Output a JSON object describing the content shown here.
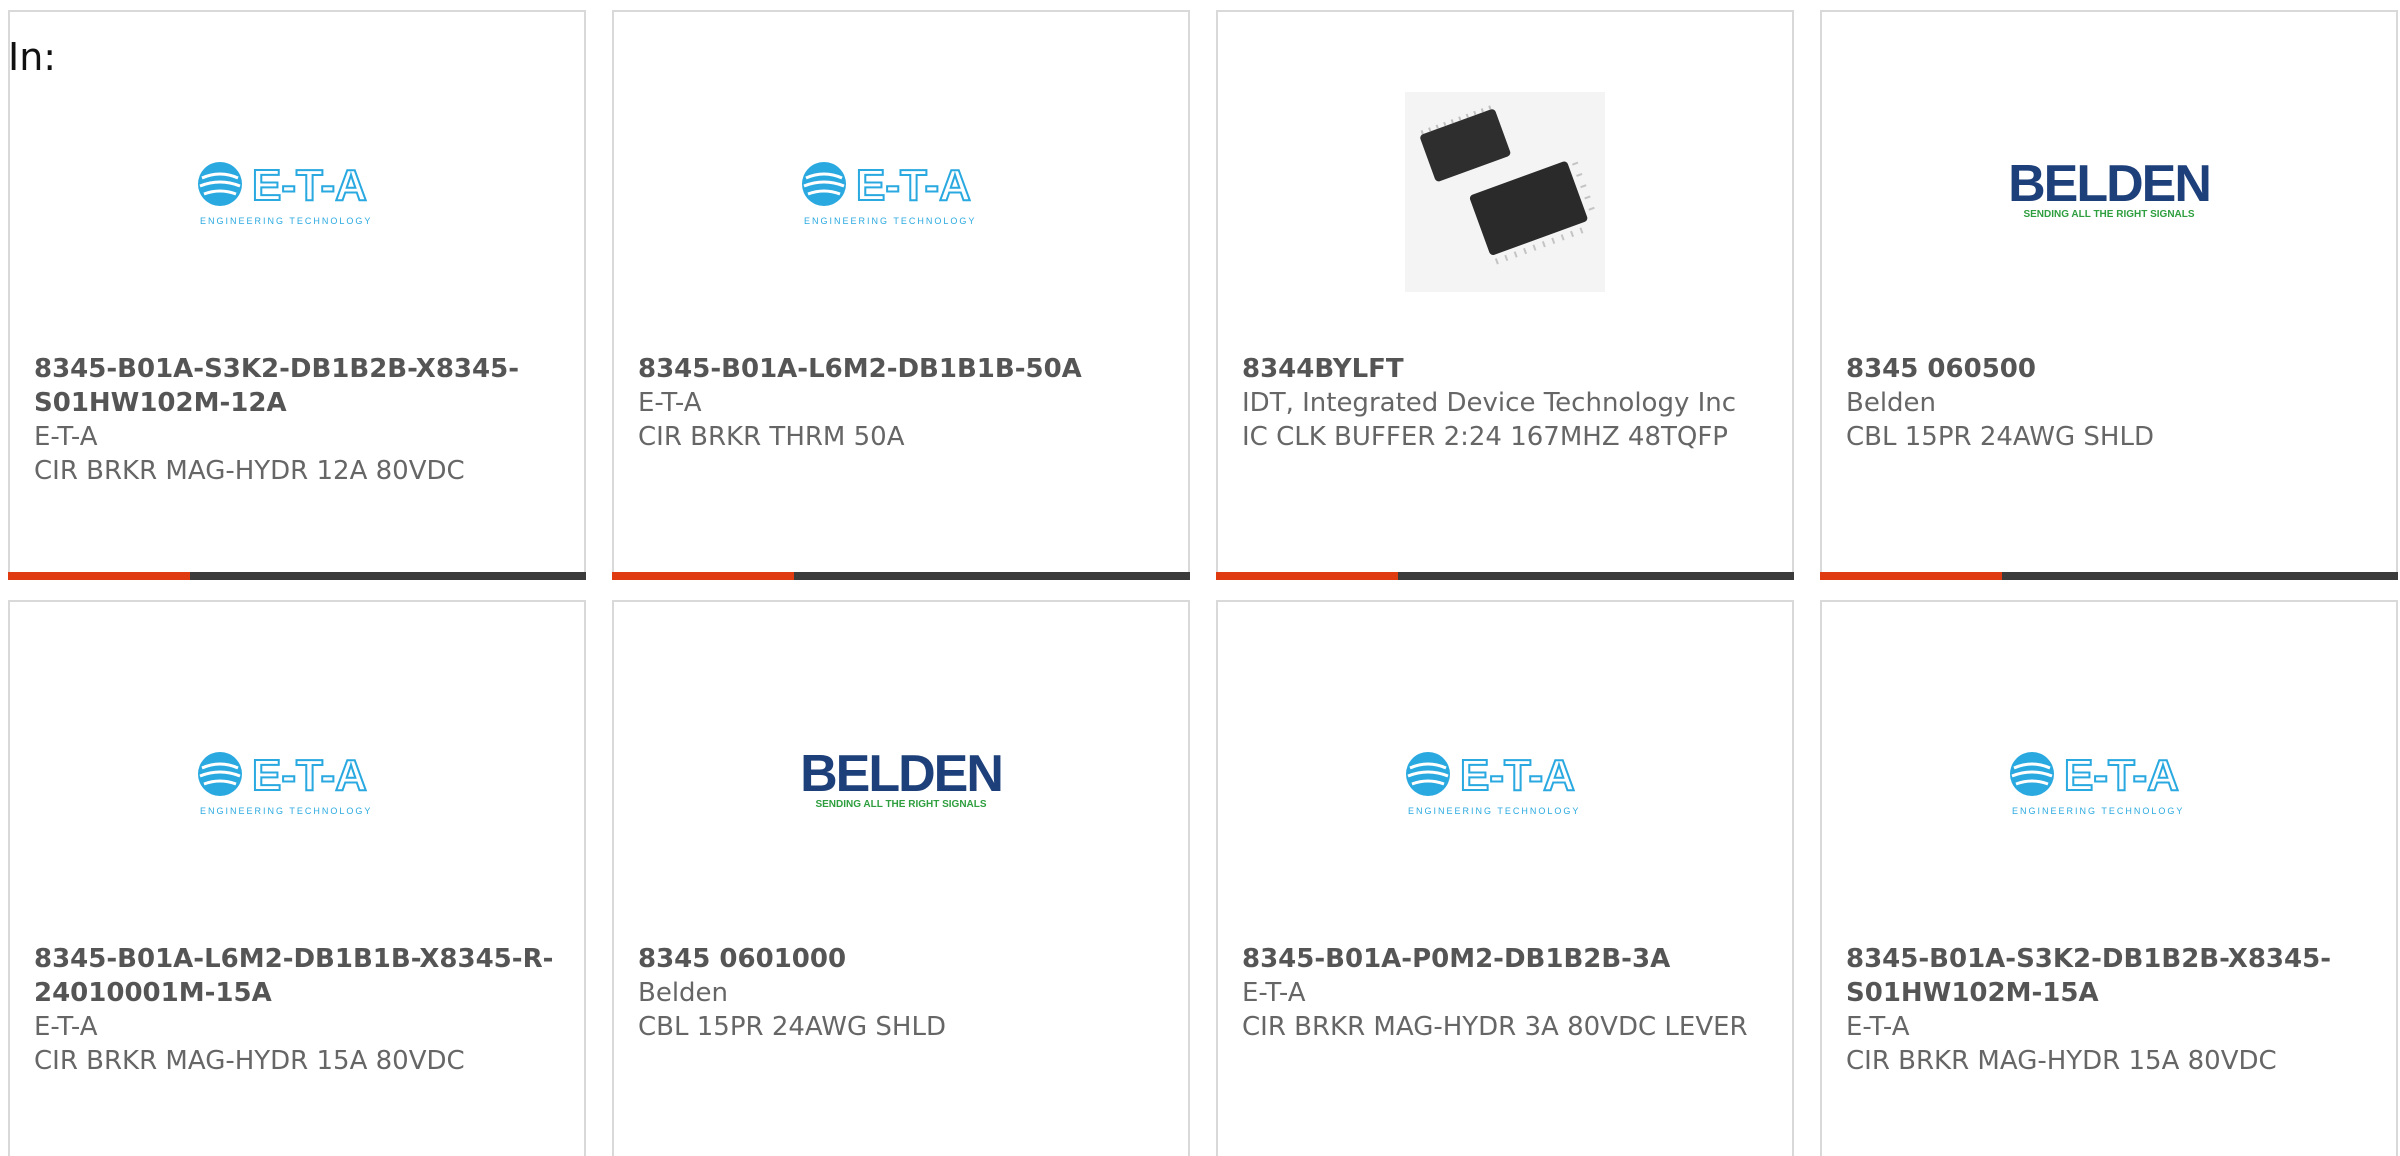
{
  "header": {
    "in_label": "In:"
  },
  "products": [
    {
      "part_number": "8345-B01A-S3K2-DB1B2B-X8345-S01HW102M-12A",
      "manufacturer": "E-T-A",
      "description": "CIR BRKR MAG-HYDR 12A 80VDC",
      "image": "eta-logo"
    },
    {
      "part_number": "8345-B01A-L6M2-DB1B1B-50A",
      "manufacturer": "E-T-A",
      "description": "CIR BRKR THRM 50A",
      "image": "eta-logo"
    },
    {
      "part_number": "8344BYLFT",
      "manufacturer": "IDT, Integrated Device Technology Inc",
      "description": "IC CLK BUFFER 2:24 167MHZ 48TQFP",
      "image": "tqfp-chip-photo"
    },
    {
      "part_number": "8345 060500",
      "manufacturer": "Belden",
      "description": "CBL 15PR 24AWG SHLD",
      "image": "belden-logo"
    },
    {
      "part_number": "8345-B01A-L6M2-DB1B1B-X8345-R-24010001M-15A",
      "manufacturer": "E-T-A",
      "description": "CIR BRKR MAG-HYDR 15A 80VDC",
      "image": "eta-logo"
    },
    {
      "part_number": "8345 0601000",
      "manufacturer": "Belden",
      "description": "CBL 15PR 24AWG SHLD",
      "image": "belden-logo"
    },
    {
      "part_number": "8345-B01A-P0M2-DB1B2B-3A",
      "manufacturer": "E-T-A",
      "description": "CIR BRKR MAG-HYDR 3A 80VDC LEVER",
      "image": "eta-logo"
    },
    {
      "part_number": "8345-B01A-S3K2-DB1B2B-X8345-S01HW102M-15A",
      "manufacturer": "E-T-A",
      "description": "CIR BRKR MAG-HYDR 15A 80VDC",
      "image": "eta-logo"
    }
  ],
  "logos": {
    "eta": {
      "text": "E-T-A",
      "tagline": "ENGINEERING TECHNOLOGY",
      "color": "#29a9e0"
    },
    "belden": {
      "text": "BELDEN",
      "tagline": "SENDING ALL THE RIGHT SIGNALS",
      "color": "#1d3f7a",
      "tagline_color": "#2e9e3e"
    }
  },
  "colors": {
    "accent": "#e03a10",
    "bar": "#3b3b3b",
    "border": "#d9d9d9"
  }
}
